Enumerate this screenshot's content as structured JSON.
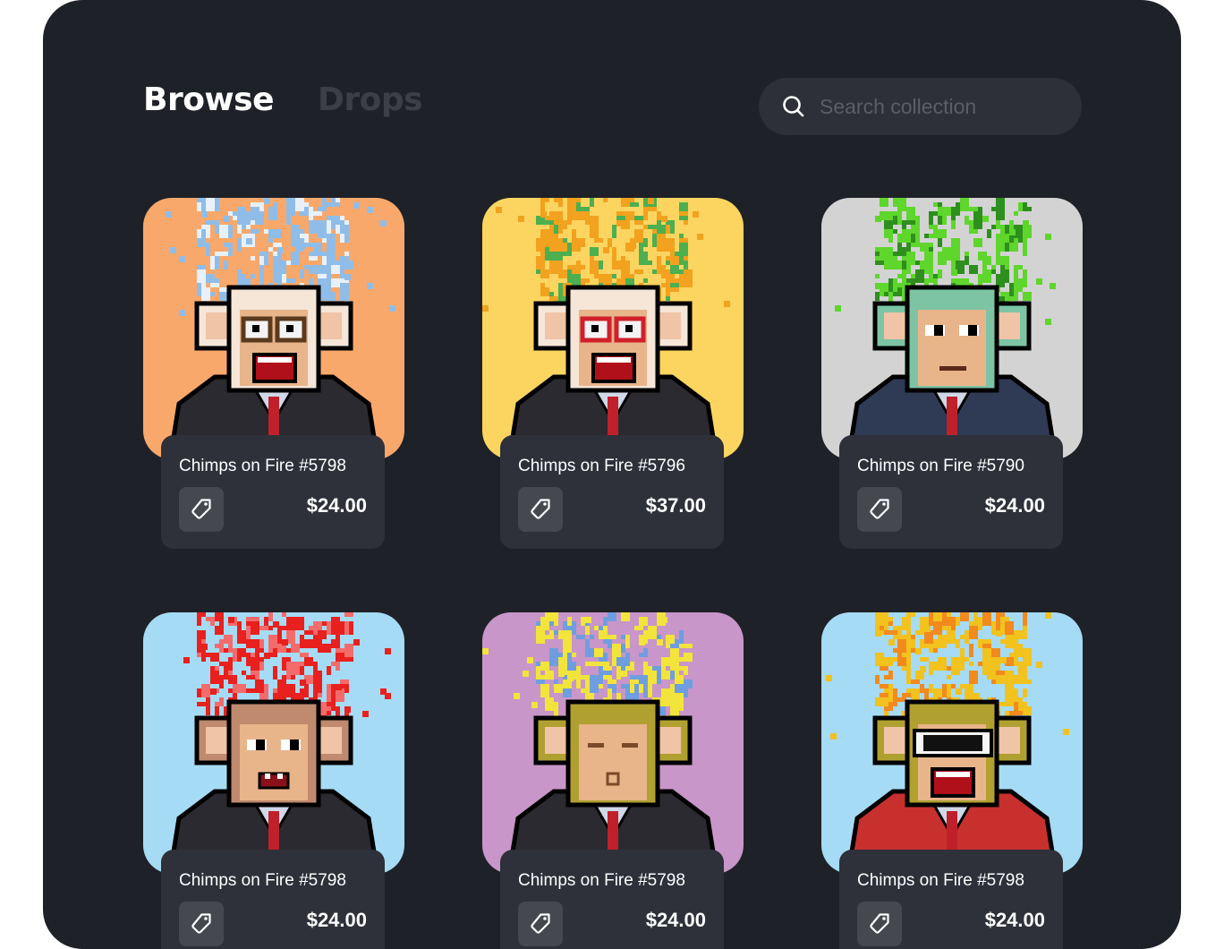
{
  "nav": {
    "tabs": [
      {
        "label": "Browse",
        "active": true
      },
      {
        "label": "Drops",
        "active": false
      }
    ]
  },
  "search": {
    "placeholder": "Search collection",
    "icon": "search-icon"
  },
  "cards": [
    {
      "name": "Chimps on Fire #5798",
      "price": "$24.00",
      "bg": "#f9a86b",
      "hair": "#8fbde8",
      "hair2": "#e8f1fa",
      "fur": "#f5e6d8",
      "eyewear": "glasses",
      "mouth": "open",
      "suit": "#2a2a30"
    },
    {
      "name": "Chimps on Fire #5796",
      "price": "$37.00",
      "bg": "#fcd560",
      "hair": "#f2a21e",
      "hair2": "#4caf50",
      "fur": "#f5e6d8",
      "eyewear": "redglasses",
      "mouth": "laugh",
      "suit": "#2a2a30"
    },
    {
      "name": "Chimps on Fire #5790",
      "price": "$24.00",
      "bg": "#d3d3d3",
      "hair": "#5ed62b",
      "hair2": "#2e8f1e",
      "fur": "#7cc4a4",
      "eyewear": "none",
      "mouth": "flat",
      "suit": "#2f3a55"
    },
    {
      "name": "Chimps on Fire #5798",
      "price": "$24.00",
      "bg": "#a6dbf5",
      "hair": "#e8201e",
      "hair2": "#f46b6b",
      "fur": "#c08a6e",
      "eyewear": "none",
      "mouth": "teeth",
      "suit": "#2a2a30"
    },
    {
      "name": "Chimps on Fire #5798",
      "price": "$24.00",
      "bg": "#c896c8",
      "hair": "#f2e43a",
      "hair2": "#6e9ee0",
      "fur": "#b0a030",
      "eyewear": "closed",
      "mouth": "kiss",
      "suit": "#2a2a30"
    },
    {
      "name": "Chimps on Fire #5798",
      "price": "$24.00",
      "bg": "#a6dbf5",
      "hair": "#f2c21e",
      "hair2": "#f28a1e",
      "fur": "#b0a030",
      "eyewear": "shades",
      "mouth": "open",
      "suit": "#c8302e"
    }
  ]
}
